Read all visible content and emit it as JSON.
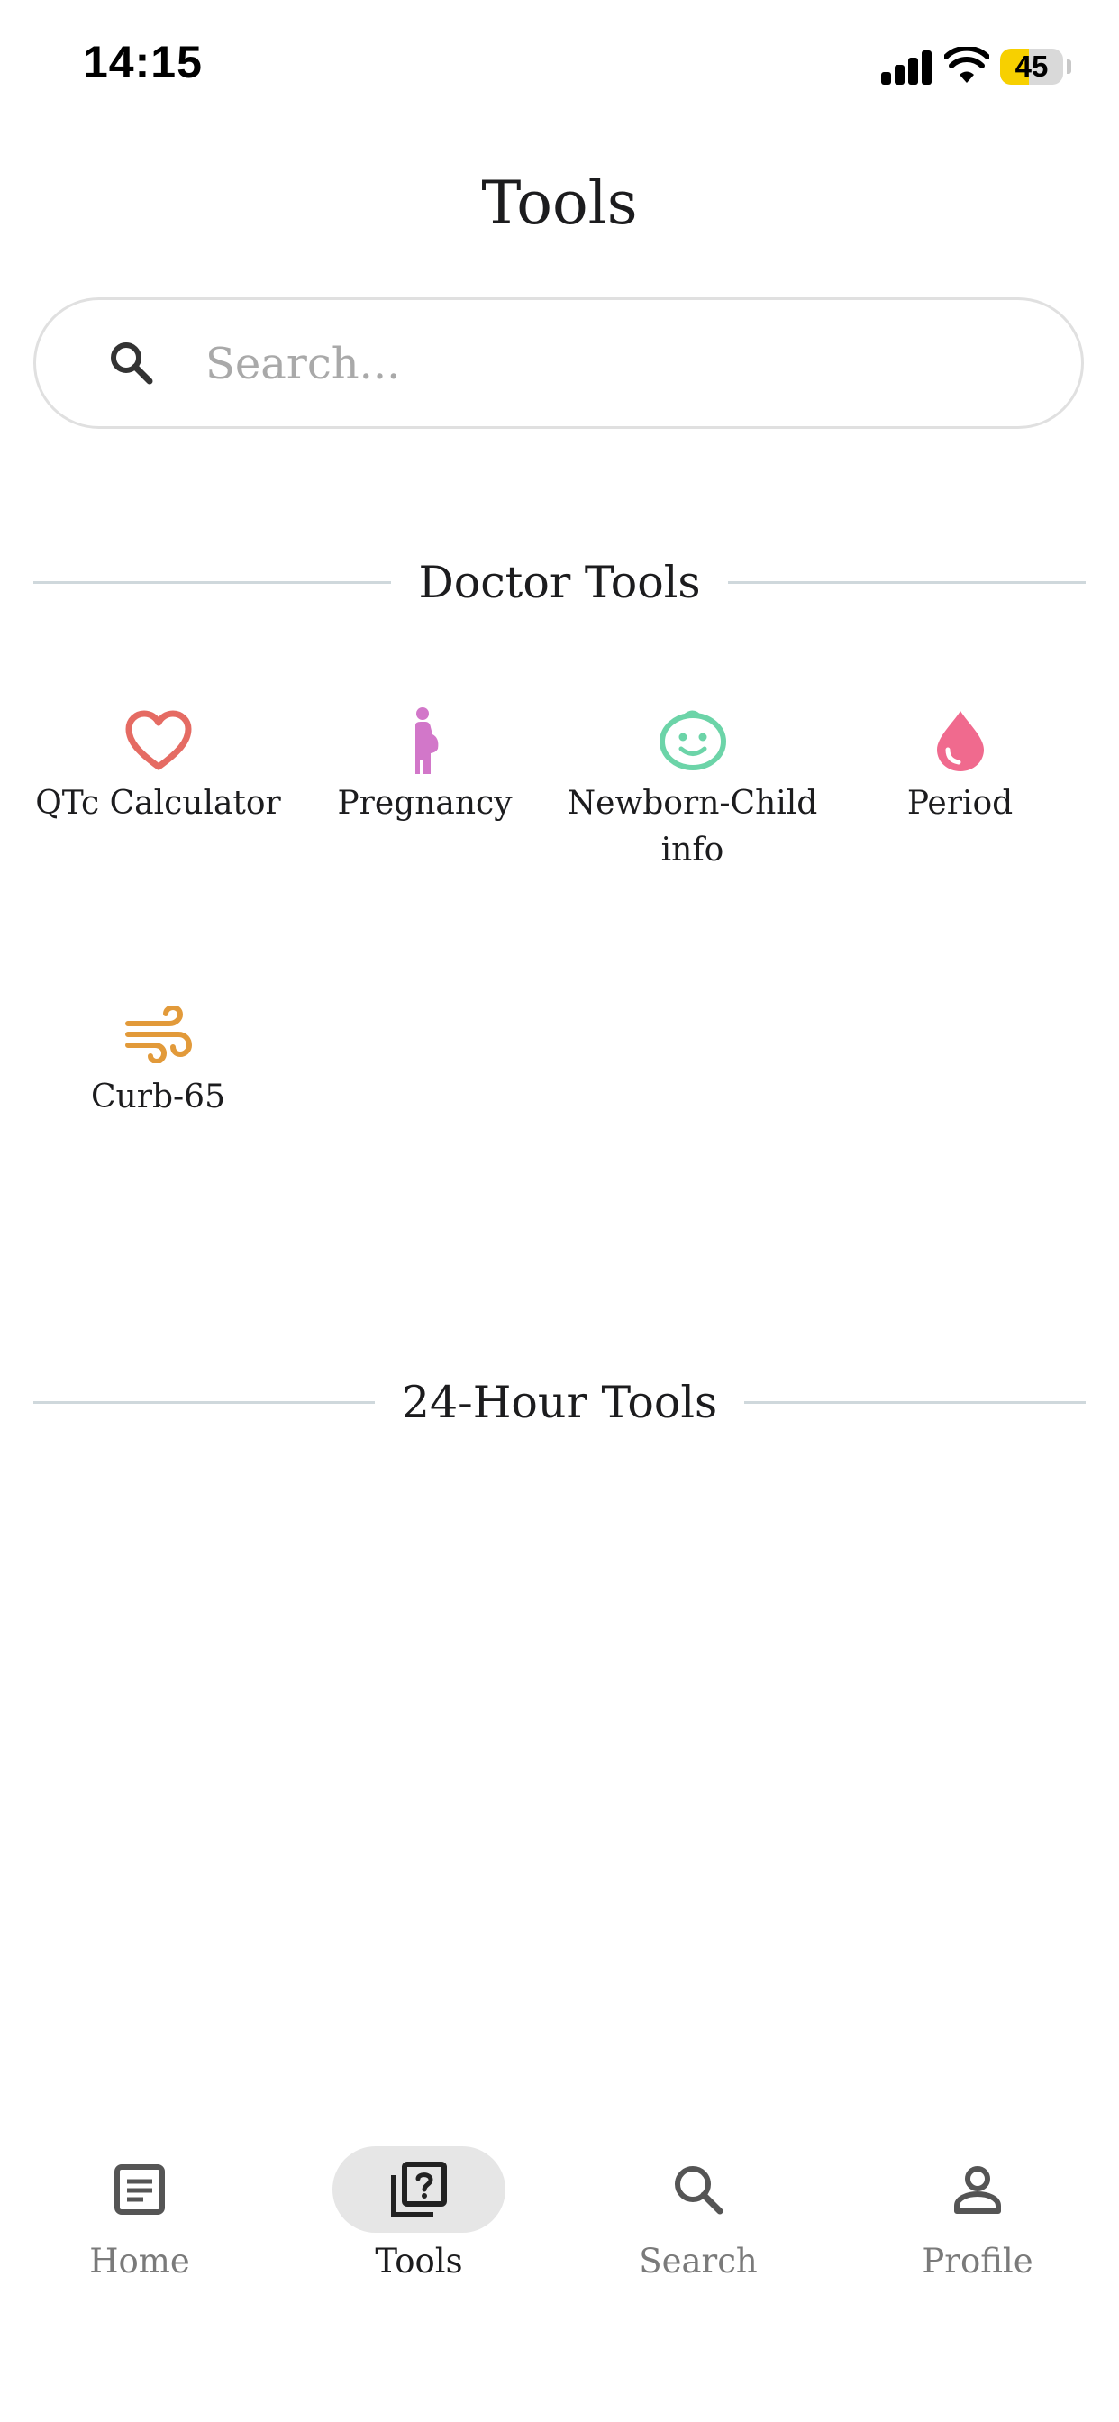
{
  "status_bar": {
    "time": "14:15",
    "battery_level": "45",
    "battery_fraction": 0.45
  },
  "header": {
    "title": "Tools"
  },
  "search": {
    "placeholder": "Search..."
  },
  "sections": {
    "doctor_tools": {
      "title": "Doctor Tools",
      "items": [
        {
          "label": "QTc Calculator",
          "icon": "heart-icon",
          "color": "#E56B63"
        },
        {
          "label": "Pregnancy",
          "icon": "pregnant-person-icon",
          "color": "#D277C9"
        },
        {
          "label": "Newborn-Child info",
          "icon": "baby-face-icon",
          "color": "#6CD4A8"
        },
        {
          "label": "Period",
          "icon": "blood-drop-icon",
          "color": "#F06A8E"
        },
        {
          "label": "Curb-65",
          "icon": "wind-icon",
          "color": "#E29A3A"
        }
      ]
    },
    "twenty_four_hour_tools": {
      "title": "24-Hour Tools"
    }
  },
  "tab_bar": {
    "tabs": [
      {
        "label": "Home",
        "icon": "document-icon",
        "active": false
      },
      {
        "label": "Tools",
        "icon": "question-box-icon",
        "active": true
      },
      {
        "label": "Search",
        "icon": "search-icon",
        "active": false
      },
      {
        "label": "Profile",
        "icon": "person-icon",
        "active": false
      }
    ]
  },
  "colors": {
    "divider": "#CFD8DC",
    "active_tab_background": "#E6E6E6",
    "inactive_tab_text": "#7A7A7A",
    "battery": "#F7D000"
  }
}
